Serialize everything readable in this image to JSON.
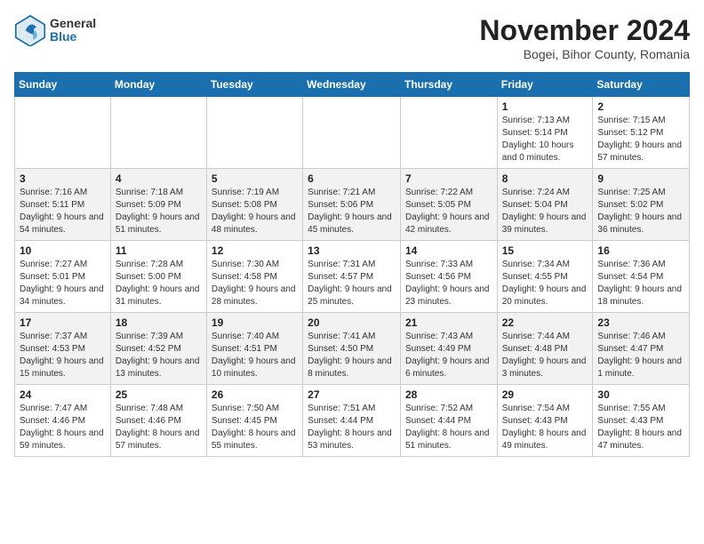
{
  "logo": {
    "general": "General",
    "blue": "Blue"
  },
  "title": "November 2024",
  "location": "Bogei, Bihor County, Romania",
  "headers": [
    "Sunday",
    "Monday",
    "Tuesday",
    "Wednesday",
    "Thursday",
    "Friday",
    "Saturday"
  ],
  "weeks": [
    [
      {
        "day": "",
        "info": ""
      },
      {
        "day": "",
        "info": ""
      },
      {
        "day": "",
        "info": ""
      },
      {
        "day": "",
        "info": ""
      },
      {
        "day": "",
        "info": ""
      },
      {
        "day": "1",
        "info": "Sunrise: 7:13 AM\nSunset: 5:14 PM\nDaylight: 10 hours and 0 minutes."
      },
      {
        "day": "2",
        "info": "Sunrise: 7:15 AM\nSunset: 5:12 PM\nDaylight: 9 hours and 57 minutes."
      }
    ],
    [
      {
        "day": "3",
        "info": "Sunrise: 7:16 AM\nSunset: 5:11 PM\nDaylight: 9 hours and 54 minutes."
      },
      {
        "day": "4",
        "info": "Sunrise: 7:18 AM\nSunset: 5:09 PM\nDaylight: 9 hours and 51 minutes."
      },
      {
        "day": "5",
        "info": "Sunrise: 7:19 AM\nSunset: 5:08 PM\nDaylight: 9 hours and 48 minutes."
      },
      {
        "day": "6",
        "info": "Sunrise: 7:21 AM\nSunset: 5:06 PM\nDaylight: 9 hours and 45 minutes."
      },
      {
        "day": "7",
        "info": "Sunrise: 7:22 AM\nSunset: 5:05 PM\nDaylight: 9 hours and 42 minutes."
      },
      {
        "day": "8",
        "info": "Sunrise: 7:24 AM\nSunset: 5:04 PM\nDaylight: 9 hours and 39 minutes."
      },
      {
        "day": "9",
        "info": "Sunrise: 7:25 AM\nSunset: 5:02 PM\nDaylight: 9 hours and 36 minutes."
      }
    ],
    [
      {
        "day": "10",
        "info": "Sunrise: 7:27 AM\nSunset: 5:01 PM\nDaylight: 9 hours and 34 minutes."
      },
      {
        "day": "11",
        "info": "Sunrise: 7:28 AM\nSunset: 5:00 PM\nDaylight: 9 hours and 31 minutes."
      },
      {
        "day": "12",
        "info": "Sunrise: 7:30 AM\nSunset: 4:58 PM\nDaylight: 9 hours and 28 minutes."
      },
      {
        "day": "13",
        "info": "Sunrise: 7:31 AM\nSunset: 4:57 PM\nDaylight: 9 hours and 25 minutes."
      },
      {
        "day": "14",
        "info": "Sunrise: 7:33 AM\nSunset: 4:56 PM\nDaylight: 9 hours and 23 minutes."
      },
      {
        "day": "15",
        "info": "Sunrise: 7:34 AM\nSunset: 4:55 PM\nDaylight: 9 hours and 20 minutes."
      },
      {
        "day": "16",
        "info": "Sunrise: 7:36 AM\nSunset: 4:54 PM\nDaylight: 9 hours and 18 minutes."
      }
    ],
    [
      {
        "day": "17",
        "info": "Sunrise: 7:37 AM\nSunset: 4:53 PM\nDaylight: 9 hours and 15 minutes."
      },
      {
        "day": "18",
        "info": "Sunrise: 7:39 AM\nSunset: 4:52 PM\nDaylight: 9 hours and 13 minutes."
      },
      {
        "day": "19",
        "info": "Sunrise: 7:40 AM\nSunset: 4:51 PM\nDaylight: 9 hours and 10 minutes."
      },
      {
        "day": "20",
        "info": "Sunrise: 7:41 AM\nSunset: 4:50 PM\nDaylight: 9 hours and 8 minutes."
      },
      {
        "day": "21",
        "info": "Sunrise: 7:43 AM\nSunset: 4:49 PM\nDaylight: 9 hours and 6 minutes."
      },
      {
        "day": "22",
        "info": "Sunrise: 7:44 AM\nSunset: 4:48 PM\nDaylight: 9 hours and 3 minutes."
      },
      {
        "day": "23",
        "info": "Sunrise: 7:46 AM\nSunset: 4:47 PM\nDaylight: 9 hours and 1 minute."
      }
    ],
    [
      {
        "day": "24",
        "info": "Sunrise: 7:47 AM\nSunset: 4:46 PM\nDaylight: 8 hours and 59 minutes."
      },
      {
        "day": "25",
        "info": "Sunrise: 7:48 AM\nSunset: 4:46 PM\nDaylight: 8 hours and 57 minutes."
      },
      {
        "day": "26",
        "info": "Sunrise: 7:50 AM\nSunset: 4:45 PM\nDaylight: 8 hours and 55 minutes."
      },
      {
        "day": "27",
        "info": "Sunrise: 7:51 AM\nSunset: 4:44 PM\nDaylight: 8 hours and 53 minutes."
      },
      {
        "day": "28",
        "info": "Sunrise: 7:52 AM\nSunset: 4:44 PM\nDaylight: 8 hours and 51 minutes."
      },
      {
        "day": "29",
        "info": "Sunrise: 7:54 AM\nSunset: 4:43 PM\nDaylight: 8 hours and 49 minutes."
      },
      {
        "day": "30",
        "info": "Sunrise: 7:55 AM\nSunset: 4:43 PM\nDaylight: 8 hours and 47 minutes."
      }
    ]
  ]
}
